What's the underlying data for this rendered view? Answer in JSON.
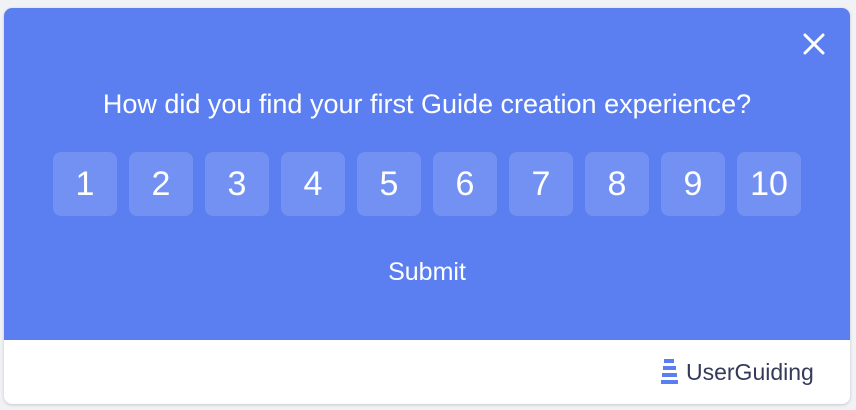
{
  "survey": {
    "question": "How did you find your first Guide creation experience?",
    "scale": [
      "1",
      "2",
      "3",
      "4",
      "5",
      "6",
      "7",
      "8",
      "9",
      "10"
    ],
    "submit_label": "Submit",
    "close_icon": "close-icon"
  },
  "footer": {
    "brand_name": "UserGuiding",
    "logo_icon": "userguiding-logo-icon"
  },
  "colors": {
    "panel": "#5b7ff0",
    "brand_text": "#343a5a",
    "logo": "#5b7ff0"
  }
}
